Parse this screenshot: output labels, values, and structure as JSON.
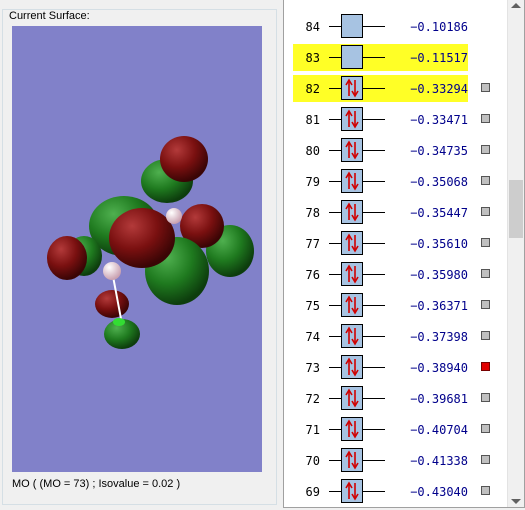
{
  "surface": {
    "title": "Current Surface:",
    "caption": "MO ( (MO = 73) ; Isovalue = 0.02 )"
  },
  "colors": {
    "viewport_bg": "#8181c9",
    "lobe_positive": "#1f7a1f",
    "lobe_negative": "#7a1010",
    "highlight": "#ffff26",
    "occupied_box": "#a7c3e2",
    "energy_text": "#00008b",
    "selected_checkbox": "#e00000"
  },
  "orbitals": [
    {
      "num": "84",
      "energy": "−0.10186",
      "occupied": false,
      "highlight": false,
      "checkbox": "none"
    },
    {
      "num": "83",
      "energy": "−0.11517",
      "occupied": false,
      "highlight": true,
      "checkbox": "none"
    },
    {
      "num": "82",
      "energy": "−0.33294",
      "occupied": true,
      "highlight": true,
      "checkbox": "gray"
    },
    {
      "num": "81",
      "energy": "−0.33471",
      "occupied": true,
      "highlight": false,
      "checkbox": "gray"
    },
    {
      "num": "80",
      "energy": "−0.34735",
      "occupied": true,
      "highlight": false,
      "checkbox": "gray"
    },
    {
      "num": "79",
      "energy": "−0.35068",
      "occupied": true,
      "highlight": false,
      "checkbox": "gray"
    },
    {
      "num": "78",
      "energy": "−0.35447",
      "occupied": true,
      "highlight": false,
      "checkbox": "gray"
    },
    {
      "num": "77",
      "energy": "−0.35610",
      "occupied": true,
      "highlight": false,
      "checkbox": "gray"
    },
    {
      "num": "76",
      "energy": "−0.35980",
      "occupied": true,
      "highlight": false,
      "checkbox": "gray"
    },
    {
      "num": "75",
      "energy": "−0.36371",
      "occupied": true,
      "highlight": false,
      "checkbox": "gray"
    },
    {
      "num": "74",
      "energy": "−0.37398",
      "occupied": true,
      "highlight": false,
      "checkbox": "gray"
    },
    {
      "num": "73",
      "energy": "−0.38940",
      "occupied": true,
      "highlight": false,
      "checkbox": "red"
    },
    {
      "num": "72",
      "energy": "−0.39681",
      "occupied": true,
      "highlight": false,
      "checkbox": "gray"
    },
    {
      "num": "71",
      "energy": "−0.40704",
      "occupied": true,
      "highlight": false,
      "checkbox": "gray"
    },
    {
      "num": "70",
      "energy": "−0.41338",
      "occupied": true,
      "highlight": false,
      "checkbox": "gray"
    },
    {
      "num": "69",
      "energy": "−0.43040",
      "occupied": true,
      "highlight": false,
      "checkbox": "gray"
    }
  ],
  "scrollbar": {
    "up_icon": "arrow-up-icon",
    "down_icon": "arrow-down-icon"
  }
}
